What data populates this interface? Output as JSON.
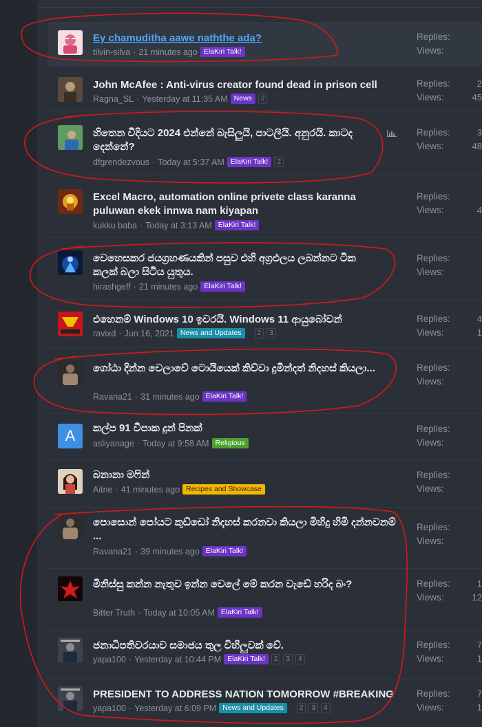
{
  "threads": [
    {
      "title": "Ey chamuditha aawe naththe ada?",
      "author": "tilvin-silva",
      "time": "21 minutes ago",
      "tag": "ElaKiri Talk!",
      "pages": [],
      "replies": "",
      "views": ""
    },
    {
      "title": "John McAfee : Anti-virus creator found dead in prison cell",
      "author": "Ragna_SL",
      "time": "Yesterday at 11:35 AM",
      "tag": "News",
      "pages": [
        "2"
      ],
      "replies": "2",
      "views": "45"
    },
    {
      "title": "හිතෙන විදියට 2024 එන්නේ බැසිලුයි, පාටලියි. අනුරයි. කාටද දෙන්නේ?",
      "author": "dfgrendezvous",
      "time": "Today at 5:37 AM",
      "tag": "ElaKiri Talk!",
      "pages": [
        "2"
      ],
      "replies": "3",
      "views": "48"
    },
    {
      "title": "Excel Macro, automation online privete class karanna puluwan ekek innwa nam kiyapan",
      "author": "kukku baba",
      "time": "Today at 3:13 AM",
      "tag": "ElaKiri Talk!",
      "pages": [],
      "replies": "",
      "views": "4"
    },
    {
      "title": "වෙහෙසකර ජයග්‍රහණයකින් පසුව එහි අග්‍රඵලය ලබන්නට ටික කලක් බලා සිටිය යුතුය.",
      "author": "hirashgeff",
      "time": "21 minutes ago",
      "tag": "ElaKiri Talk!",
      "pages": [],
      "replies": "",
      "views": ""
    },
    {
      "title": "එහෙනම් Windows 10 ඉවරයි. Windows 11 ආයුබෝවන්",
      "author": "ravixd",
      "time": "Jun 16, 2021",
      "tag": "News and Updates",
      "pages": [
        "2",
        "3"
      ],
      "replies": "4",
      "views": "1"
    },
    {
      "title": "ගෝඨා දින්න වෙලාවේ ටොයියෙක් කිව්වා දුමින්දත් නිදහස් කියලා...",
      "author": "Ravana21",
      "time": "31 minutes ago",
      "tag": "ElaKiri Talk!",
      "pages": [],
      "replies": "",
      "views": ""
    },
    {
      "title": "කල්ප 91 විපාක දුන් පිනක්",
      "author": "asliyanage",
      "time": "Today at 9:58 AM",
      "tag": "Religious",
      "pages": [],
      "replies": "",
      "views": ""
    },
    {
      "title": "බනානා මෆින්",
      "author": "Aitne",
      "time": "41 minutes ago",
      "tag": "Recipes and Showcase",
      "pages": [],
      "replies": "",
      "views": ""
    },
    {
      "title": "පොසොන් පෝයට කුඩ්ඩෝ නිදහස් කරනවා කියලා මිහිදු හිමි දන්නවනම් ...",
      "author": "Ravana21",
      "time": "39 minutes ago",
      "tag": "ElaKiri Talk!",
      "pages": [],
      "replies": "",
      "views": ""
    },
    {
      "title": "මිනිස්සු කන්න නැතුව ඉන්න වෙලේ මේ කරන වැඩේ හරිද බං?",
      "author": "Bitter Truth",
      "time": "Today at 10:05 AM",
      "tag": "ElaKiri Talk!",
      "pages": [],
      "replies": "1",
      "views": "12"
    },
    {
      "title": "ජනාධිපතිවරයාව සමාජය තුල විහිලුවක් වේ.",
      "author": "yapa100",
      "time": "Yesterday at 10:44 PM",
      "tag": "ElaKiri Talk!",
      "pages": [
        "2",
        "3",
        "4"
      ],
      "replies": "7",
      "views": "1"
    },
    {
      "title": "PRESIDENT TO ADDRESS NATION TOMORROW #BREAKING",
      "author": "yapa100",
      "time": "Yesterday at 6:09 PM",
      "tag": "News and Updates",
      "pages": [
        "2",
        "3",
        "4"
      ],
      "replies": "7",
      "views": "1"
    }
  ],
  "labels": {
    "replies": "Replies:",
    "views": "Views:"
  },
  "avatar_letter": "A",
  "colors": {
    "accent_link": "#4ea7ff",
    "tag_purple": "#6c34c4",
    "tag_teal": "#1b8fa8",
    "tag_green": "#4f9f2e",
    "tag_yellow": "#f3b500",
    "annotation_red": "#d81818"
  }
}
